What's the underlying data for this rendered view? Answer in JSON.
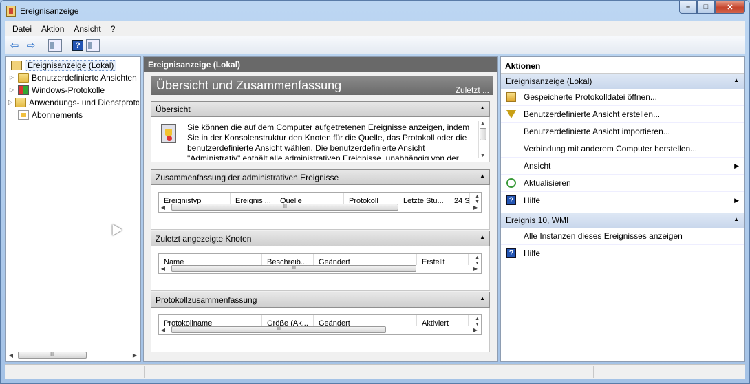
{
  "window": {
    "title": "Ereignisanzeige",
    "minimize": "–",
    "maximize": "□",
    "close": "✕"
  },
  "menu": [
    "Datei",
    "Aktion",
    "Ansicht",
    "?"
  ],
  "toolbar": {
    "back": "⇦",
    "forward": "⇨",
    "help": "?"
  },
  "tree": {
    "root": "Ereignisanzeige (Lokal)",
    "items": [
      "Benutzerdefinierte Ansichten",
      "Windows-Protokolle",
      "Anwendungs- und Dienstprotokolle",
      "Abonnements"
    ],
    "thumb": "III"
  },
  "center": {
    "header": "Ereignisanzeige (Lokal)",
    "banner_title": "Übersicht und Zusammenfassung",
    "banner_link": "Zuletzt ...",
    "overview": {
      "title": "Übersicht",
      "text": "Sie können die auf dem Computer aufgetretenen Ereignisse anzeigen, indem Sie in der Konsolenstruktur den Knoten für die Quelle, das Protokoll oder die benutzerdefinierte Ansicht wählen. Die benutzerdefinierte Ansicht \"Administrativ\" enthält alle administrativen Ereignisse, unabhängig von der"
    },
    "summary": {
      "title": "Zusammenfassung der administrativen Ereignisse",
      "columns": [
        "Ereignistyp",
        "Ereignis ...",
        "Quelle",
        "Protokoll",
        "Letzte Stu...",
        "24 S"
      ]
    },
    "recent": {
      "title": "Zuletzt angezeigte Knoten",
      "columns": [
        "Name",
        "Beschreib...",
        "Geändert",
        "Erstellt"
      ]
    },
    "logsummary": {
      "title": "Protokollzusammenfassung",
      "columns": [
        "Protokollname",
        "Größe (Ak...",
        "Geändert",
        "Aktiviert"
      ]
    },
    "scroll_thumb": "III"
  },
  "actions": {
    "header": "Aktionen",
    "group1": {
      "title": "Ereignisanzeige (Lokal)",
      "items": [
        {
          "label": "Gespeicherte Protokolldatei öffnen...",
          "icon": "open-log-icon"
        },
        {
          "label": "Benutzerdefinierte Ansicht erstellen...",
          "icon": "filter-icon"
        },
        {
          "label": "Benutzerdefinierte Ansicht importieren...",
          "icon": "none"
        },
        {
          "label": "Verbindung mit anderem Computer herstellen...",
          "icon": "none"
        },
        {
          "label": "Ansicht",
          "icon": "none",
          "submenu": true
        },
        {
          "label": "Aktualisieren",
          "icon": "refresh-icon"
        },
        {
          "label": "Hilfe",
          "icon": "help-icon",
          "submenu": true
        }
      ]
    },
    "group2": {
      "title": "Ereignis 10, WMI",
      "items": [
        {
          "label": "Alle Instanzen dieses Ereignisses anzeigen",
          "icon": "none"
        },
        {
          "label": "Hilfe",
          "icon": "help-icon"
        }
      ]
    }
  }
}
